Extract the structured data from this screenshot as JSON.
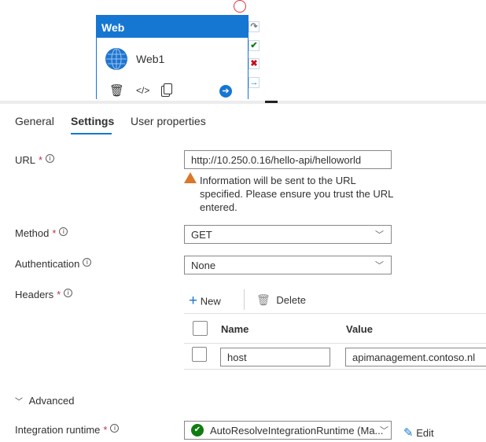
{
  "node": {
    "title": "Web",
    "name": "Web1",
    "actions": [
      "delete-icon",
      "code-icon",
      "copy-icon",
      "arrow-right-icon"
    ]
  },
  "tabs": [
    {
      "label": "General"
    },
    {
      "label": "Settings",
      "active": true
    },
    {
      "label": "User properties"
    }
  ],
  "form": {
    "url": {
      "label": "URL",
      "required": "*",
      "value": "http://10.250.0.16/hello-api/helloworld",
      "warning": "Information will be sent to the URL specified. Please ensure you trust the URL entered."
    },
    "method": {
      "label": "Method",
      "required": "*",
      "value": "GET"
    },
    "authentication": {
      "label": "Authentication",
      "value": "None"
    },
    "headers": {
      "label": "Headers",
      "required": "*",
      "new_label": "New",
      "delete_label": "Delete",
      "columns": [
        "Name",
        "Value"
      ],
      "rows": [
        {
          "name": "host",
          "value": "apimanagement.contoso.nl"
        }
      ]
    },
    "advanced": {
      "label": "Advanced"
    },
    "integration_runtime": {
      "label": "Integration runtime",
      "required": "*",
      "value": "AutoResolveIntegrationRuntime (Ma...",
      "edit_label": "Edit"
    }
  },
  "colors": {
    "accent": "#1677d2",
    "required": "#c4314b",
    "warning": "#d9782a",
    "success": "#107c10"
  }
}
